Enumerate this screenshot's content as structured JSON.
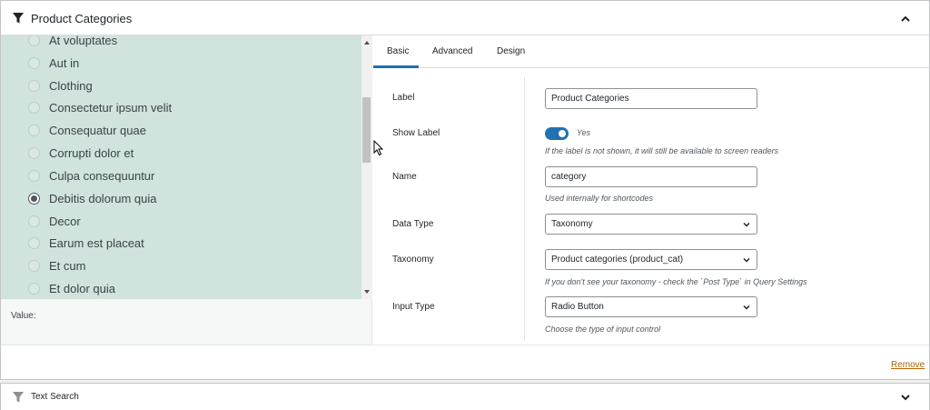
{
  "panel": {
    "title": "Product Categories",
    "icon": "funnel-icon",
    "collapse_icon": "chevron-up-icon"
  },
  "list": {
    "items": [
      {
        "label": "At voluptates",
        "checked": false
      },
      {
        "label": "Aut in",
        "checked": false
      },
      {
        "label": "Clothing",
        "checked": false
      },
      {
        "label": "Consectetur ipsum velit",
        "checked": false
      },
      {
        "label": "Consequatur quae",
        "checked": false
      },
      {
        "label": "Corrupti dolor et",
        "checked": false
      },
      {
        "label": "Culpa consequuntur",
        "checked": false
      },
      {
        "label": "Debitis dolorum quia",
        "checked": true
      },
      {
        "label": "Decor",
        "checked": false
      },
      {
        "label": "Earum est placeat",
        "checked": false
      },
      {
        "label": "Et cum",
        "checked": false
      },
      {
        "label": "Et dolor quia",
        "checked": false
      }
    ],
    "value_label": "Value:"
  },
  "tabs": [
    {
      "label": "Basic",
      "active": true
    },
    {
      "label": "Advanced",
      "active": false
    },
    {
      "label": "Design",
      "active": false
    }
  ],
  "fields": {
    "label": {
      "label": "Label",
      "value": "Product Categories"
    },
    "show_label": {
      "label": "Show Label",
      "state": "Yes",
      "help": "If the label is not shown, it will still be available to screen readers"
    },
    "name": {
      "label": "Name",
      "value": "category",
      "help": "Used internally for shortcodes"
    },
    "data_type": {
      "label": "Data Type",
      "value": "Taxonomy"
    },
    "taxonomy": {
      "label": "Taxonomy",
      "value": "Product categories (product_cat)",
      "help": "If you don't see your taxonomy - check the `Post Type` in Query Settings"
    },
    "input_type": {
      "label": "Input Type",
      "value": "Radio Button",
      "help": "Choose the type of input control"
    }
  },
  "footer": {
    "remove_label": "Remove"
  },
  "panel2": {
    "title": "Text Search",
    "icon": "funnel-icon",
    "expand_icon": "chevron-down-icon"
  },
  "colors": {
    "accent": "#2271b1",
    "list_bg": "#d0e3dc",
    "remove_link": "#b26200"
  }
}
